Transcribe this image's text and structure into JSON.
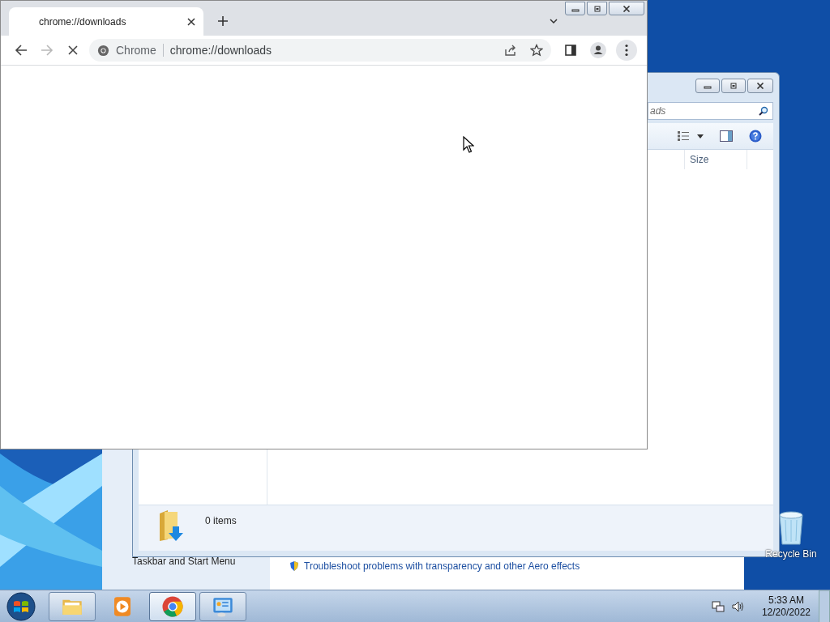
{
  "desktop": {
    "icons": [
      {
        "label": "Recycle Bin"
      }
    ]
  },
  "control_panel_window": {
    "sidebar_link": "Taskbar and Start Menu",
    "task_link": "Troubleshoot problems with transparency and other Aero effects"
  },
  "explorer_window": {
    "search": {
      "placeholder": "ads"
    },
    "columns": [
      "Size"
    ],
    "status": "0 items"
  },
  "chrome_window": {
    "tabs": [
      {
        "title": "chrome://downloads",
        "selected": true
      }
    ],
    "loading": true,
    "forward_disabled": true,
    "omnibox": {
      "chip": "Chrome",
      "url": "chrome://downloads"
    }
  },
  "taskbar": {
    "items": [
      {
        "kind": "explorer",
        "running": true,
        "selected": false
      },
      {
        "kind": "media",
        "running": false,
        "selected": false
      },
      {
        "kind": "chrome",
        "running": true,
        "selected": true
      },
      {
        "kind": "control-panel",
        "running": true,
        "selected": false
      }
    ],
    "time": "5:33 AM",
    "date": "12/20/2022"
  }
}
